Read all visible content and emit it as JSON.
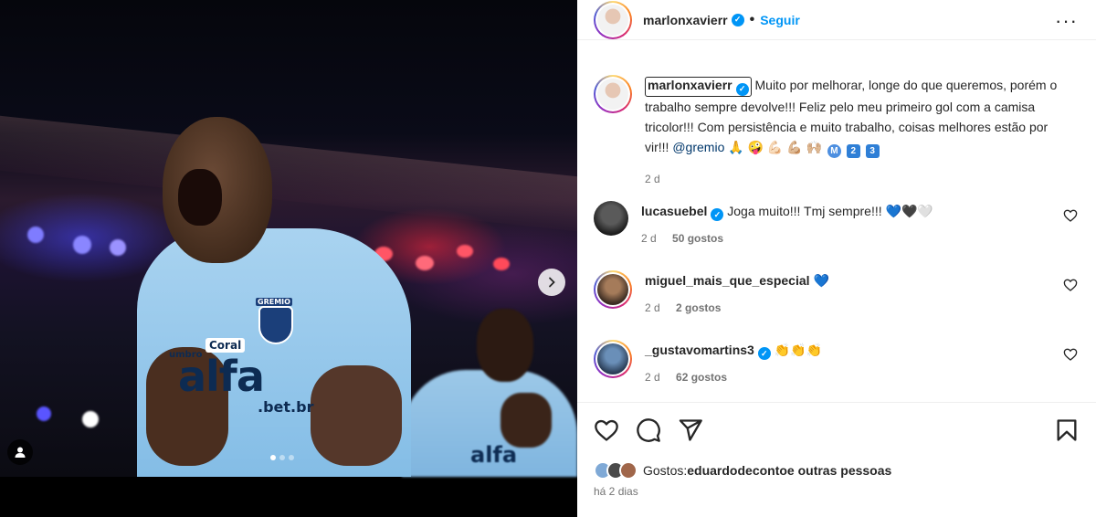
{
  "media": {
    "sponsor_text": "alfa",
    "sponsor_sub": ".bet.br",
    "crest_text": "GREMIO",
    "shirt_brand": "Coral",
    "kit_brand": "umbro",
    "carousel_count": 3,
    "carousel_active": 0,
    "next_icon": "chevron-right-icon",
    "tag_icon": "user-tag-icon"
  },
  "header": {
    "username": "marlonxavierr",
    "separator": "•",
    "follow_label": "Seguir",
    "more_label": "···"
  },
  "caption": {
    "username": "marlonxavierr",
    "text": " Muito por melhorar, longe do que queremos, porém o trabalho sempre devolve!!! Feliz pelo meu primeiro gol com a camisa tricolor!!! Com persistência e muito trabalho, coisas melhores estão por vir!!! ",
    "mention": "@gremio",
    "emojis": "🙏 🤪 💪🏻 💪🏼 🙌🏼",
    "chip_m": "M",
    "chip_2": "2",
    "chip_3": "3",
    "time": "2 d"
  },
  "comments": [
    {
      "username": "lucasuebel",
      "verified": true,
      "text": "Joga muito!!! Tmj sempre!!! 💙🖤🤍",
      "time": "2 d",
      "likes": "50 gostos"
    },
    {
      "username": "miguel_mais_que_especial",
      "verified": false,
      "text": "💙",
      "time": "2 d",
      "likes": "2 gostos"
    },
    {
      "username": "_gustavomartins3",
      "verified": true,
      "text": "👏👏👏",
      "time": "2 d",
      "likes": "62 gostos"
    }
  ],
  "likes": {
    "prefix": "Gostos: ",
    "user": "eduardodeconto",
    "suffix": " e outras pessoas"
  },
  "post_time": "há 2 dias",
  "colors": {
    "accent": "#0095f6",
    "verified": "#0095f6",
    "muted": "#737373",
    "text": "#262626",
    "mention": "#00376b"
  }
}
